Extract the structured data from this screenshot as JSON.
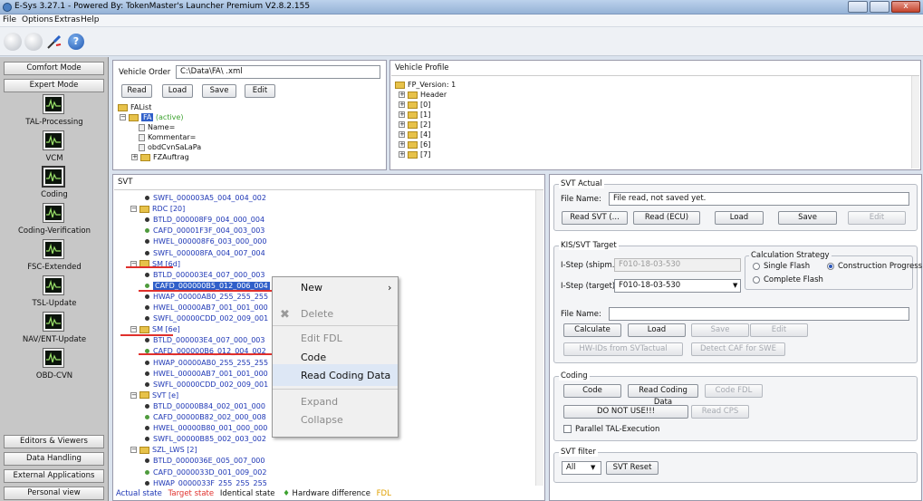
{
  "window": {
    "title": "E-Sys 3.27.1 - Powered By: TokenMaster's Launcher Premium V2.8.2.155",
    "close_glyph": "x"
  },
  "menu": [
    "File",
    "Options",
    "Extras",
    "Help"
  ],
  "sidebar": {
    "top_buttons": [
      "Comfort Mode",
      "Expert Mode"
    ],
    "items": [
      "TAL-Processing",
      "VCM",
      "Coding",
      "Coding-Verification",
      "FSC-Extended",
      "TSL-Update",
      "NAV/ENT-Update",
      "OBD-CVN"
    ],
    "bottom_buttons": [
      "Editors & Viewers",
      "Data Handling",
      "External Applications",
      "Personal view"
    ]
  },
  "vehicle_order": {
    "label": "Vehicle Order",
    "path": "C:\\Data\\FA\\            .xml",
    "buttons": [
      "Read",
      "Load",
      "Save",
      "Edit"
    ],
    "tree": {
      "root": "FAList",
      "fa": "FA",
      "fa_state": "(active)",
      "children": [
        "Name=",
        "Kommentar=",
        "obdCvnSaLaPa",
        "FZAuftrag"
      ]
    }
  },
  "vehicle_profile": {
    "label": "Vehicle Profile",
    "root": "FP_Version: 1",
    "items": [
      "Header",
      "[0]",
      "[1]",
      "[2]",
      "[4]",
      "[6]",
      "[7]"
    ]
  },
  "svt": {
    "label": "SVT",
    "rows": [
      {
        "t": "SWFL_000003A5_004_004_002",
        "k": "d",
        "d": 2
      },
      {
        "t": "RDC [20]",
        "k": "f",
        "d": 1
      },
      {
        "t": "BTLD_000008F9_004_000_004",
        "k": "d",
        "d": 2
      },
      {
        "t": "CAFD_00001F3F_004_003_003",
        "k": "g",
        "d": 2
      },
      {
        "t": "HWEL_000008F6_003_000_000",
        "k": "d",
        "d": 2
      },
      {
        "t": "SWFL_000008FA_004_007_004",
        "k": "d",
        "d": 2
      },
      {
        "t": "SM [6d]",
        "k": "f",
        "d": 1
      },
      {
        "t": "BTLD_000003E4_007_000_003",
        "k": "d",
        "d": 2
      },
      {
        "t": "CAFD_000000B5_012_006_004",
        "k": "g",
        "d": 2,
        "sel": true
      },
      {
        "t": "HWAP_00000AB0_255_255_255",
        "k": "d",
        "d": 2
      },
      {
        "t": "HWEL_00000AB7_001_001_000",
        "k": "d",
        "d": 2
      },
      {
        "t": "SWFL_00000CDD_002_009_001",
        "k": "d",
        "d": 2
      },
      {
        "t": "SM [6e]",
        "k": "f",
        "d": 1
      },
      {
        "t": "BTLD_000003E4_007_000_003",
        "k": "d",
        "d": 2
      },
      {
        "t": "CAFD_000000B6_012_004_002",
        "k": "g",
        "d": 2
      },
      {
        "t": "HWAP_00000AB0_255_255_255",
        "k": "d",
        "d": 2
      },
      {
        "t": "HWEL_00000AB7_001_001_000",
        "k": "d",
        "d": 2
      },
      {
        "t": "SWFL_00000CDD_002_009_001",
        "k": "d",
        "d": 2
      },
      {
        "t": "SVT [e]",
        "k": "f",
        "d": 1
      },
      {
        "t": "BTLD_00000B84_002_001_000",
        "k": "d",
        "d": 2
      },
      {
        "t": "CAFD_00000B82_002_000_008",
        "k": "g",
        "d": 2
      },
      {
        "t": "HWEL_00000B80_001_000_000",
        "k": "d",
        "d": 2
      },
      {
        "t": "SWFL_00000B85_002_003_002",
        "k": "d",
        "d": 2
      },
      {
        "t": "SZL_LWS [2]",
        "k": "f",
        "d": 1
      },
      {
        "t": "BTLD_0000036E_005_007_000",
        "k": "d",
        "d": 2
      },
      {
        "t": "CAFD_0000033D_001_009_002",
        "k": "g",
        "d": 2
      },
      {
        "t": "HWAP_0000033F_255_255_255",
        "k": "d",
        "d": 2
      }
    ]
  },
  "context_menu": {
    "items": [
      "New",
      "Delete",
      "Edit FDL",
      "Code",
      "Read Coding Data",
      "Expand",
      "Collapse"
    ]
  },
  "legend": {
    "actual": "Actual state",
    "target": "Target state",
    "identical": "Identical state",
    "hw": "Hardware difference",
    "fdl": "FDL"
  },
  "svt_actual": {
    "label": "SVT Actual",
    "file_label": "File Name:",
    "file_value": "File read, not saved yet.",
    "buttons": [
      "Read SVT (...",
      "Read (ECU)",
      "Load",
      "Save",
      "Edit"
    ]
  },
  "kis": {
    "label": "KIS/SVT Target",
    "shipm_label": "I-Step (shipm.):",
    "shipm_value": "F010-18-03-530",
    "target_label": "I-Step (target):",
    "target_value": "F010-18-03-530",
    "calc_label": "Calculation Strategy",
    "opt_single": "Single Flash",
    "opt_complete": "Complete Flash",
    "opt_progress": "Construction Progress",
    "file_label": "File Name:",
    "buttons": [
      "Calculate",
      "Load",
      "Save",
      "Edit"
    ],
    "btn_hw": "HW-IDs from SVTactual",
    "btn_detect": "Detect CAF for SWE"
  },
  "coding": {
    "label": "Coding",
    "btn_code": "Code",
    "btn_read": "Read Coding Data",
    "btn_fdl": "Code FDL",
    "btn_donot": "DO NOT USE!!!",
    "btn_cps": "Read CPS",
    "parallel": "Parallel TAL-Execution"
  },
  "svt_filter": {
    "label": "SVT filter",
    "value": "All",
    "reset": "SVT Reset"
  },
  "colors": {
    "red_annotation": "#e0302c",
    "actual_state": "#1d36b5",
    "target_state": "#e0302c",
    "fdl": "#e0a000"
  }
}
